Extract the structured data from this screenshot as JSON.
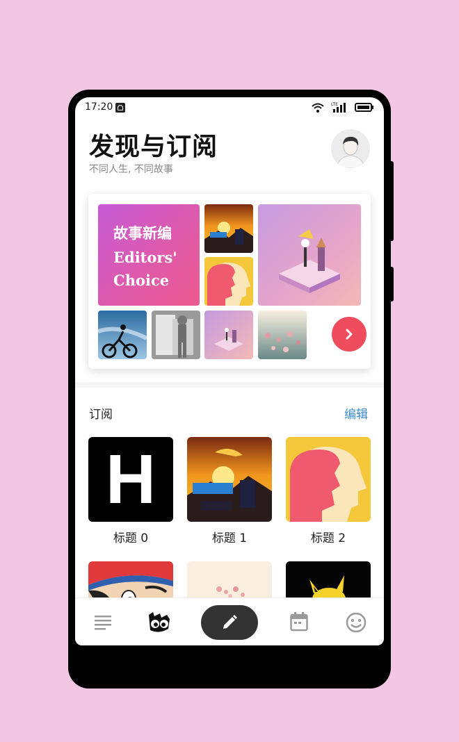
{
  "status_bar": {
    "time": "17:20",
    "network_label": "LTE"
  },
  "header": {
    "title": "发现与订阅",
    "subtitle": "不同人生, 不同故事"
  },
  "featured": {
    "editors_title_cn": "故事新编",
    "editors_line1": "Editors'",
    "editors_line2": "Choice",
    "thumbs": [
      "pokemon-sunset",
      "face-silhouette",
      "monument-valley-large",
      "cyclist-sky",
      "just-do-it",
      "monument-valley-small",
      "flowers"
    ],
    "more_icon": "chevron-right-icon"
  },
  "subscriptions": {
    "label": "订阅",
    "edit_label": "编辑",
    "items": [
      {
        "title": "标题 0",
        "thumb": "letter-h",
        "letter": "H"
      },
      {
        "title": "标题 1",
        "thumb": "pokemon-sunset"
      },
      {
        "title": "标题 2",
        "thumb": "face-silhouette"
      },
      {
        "title": "",
        "thumb": "ash-cartoon"
      },
      {
        "title": "",
        "thumb": "flowers-pale"
      },
      {
        "title": "",
        "thumb": "pikachu-black"
      }
    ]
  },
  "tabbar": {
    "items": [
      "list-icon",
      "discover-face-icon",
      "compose-pen-icon",
      "calendar-icon",
      "smiley-icon"
    ]
  },
  "colors": {
    "accent": "#3a8fd6",
    "more_button": "#ef4d5e",
    "fab": "#333333",
    "background": "#f3c7e3"
  }
}
